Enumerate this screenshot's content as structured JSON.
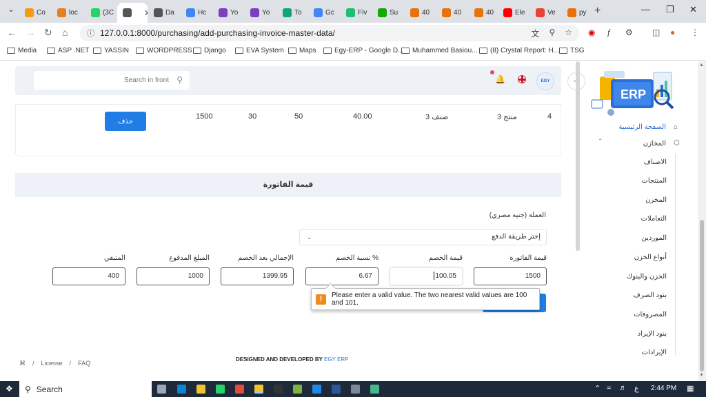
{
  "browser": {
    "tabs": [
      {
        "title": "Co",
        "color": "#f39c12"
      },
      {
        "title": "loc",
        "color": "#e67e22"
      },
      {
        "title": "(3C",
        "color": "#25d366"
      },
      {
        "title": "",
        "color": "#555555",
        "active": true
      },
      {
        "title": "Da",
        "color": "#555555"
      },
      {
        "title": "Hc",
        "color": "#4285f4"
      },
      {
        "title": "Yo",
        "color": "#7b3fbf"
      },
      {
        "title": "Yo",
        "color": "#7b3fbf"
      },
      {
        "title": "To",
        "color": "#10a37f"
      },
      {
        "title": "Gc",
        "color": "#4285f4"
      },
      {
        "title": "Fiv",
        "color": "#1dbf73"
      },
      {
        "title": "Su",
        "color": "#14a800"
      },
      {
        "title": "40",
        "color": "#e8710a"
      },
      {
        "title": "40",
        "color": "#e8710a"
      },
      {
        "title": "40",
        "color": "#e8710a"
      },
      {
        "title": "Ele",
        "color": "#ff0000"
      },
      {
        "title": "Ve",
        "color": "#ea4335"
      },
      {
        "title": "py",
        "color": "#e8710a"
      }
    ],
    "url": "127.0.0.1:8000/purchasing/add-purchasing-invoice-master-data/",
    "bookmarks": [
      "Media",
      "ASP .NET",
      "YASSIN",
      "WORDPRESS",
      "Django",
      "EVA System",
      "Maps",
      "Egy-ERP - Google D...",
      "Muhammed Basiou...",
      "(8) Crystal Report: H...",
      "TSG"
    ]
  },
  "topbar": {
    "search_placeholder": "Search in front",
    "avatar_text": "EGY"
  },
  "table_row": {
    "index": "4",
    "product": "منتج 3",
    "category": "صنف 3",
    "price": "40.00",
    "qty": "50",
    "discount": "30",
    "total": "1500",
    "delete_label": "حذف"
  },
  "invoice": {
    "section_title": "قيمة الفاتورة",
    "currency_label": "العملة (جنيه مصري)",
    "payment_placeholder": "إختر طريقة الدفع",
    "fields": {
      "invoice_value": {
        "label": "قيمة الفاتورة",
        "value": "1500"
      },
      "discount_value": {
        "label": "قيمة الخصم",
        "value": "100.05"
      },
      "discount_percent": {
        "label": "نسبة الخصم %",
        "value": "6.67"
      },
      "total_after_discount": {
        "label": "الإجمالي بعد الخصم",
        "value": "1399.95"
      },
      "paid_amount": {
        "label": "المبلغ المدفوع",
        "value": "1000"
      },
      "remaining": {
        "label": "المتبقي",
        "value": "400"
      }
    },
    "validation_message": "Please enter a valid value. The two nearest valid values are 100 and 101."
  },
  "footer": {
    "license": "License",
    "faq": "FAQ",
    "credit": "DESIGNED AND DEVELOPED BY",
    "brand": "EGY ERP"
  },
  "sidebar": {
    "logo_text": "ERP",
    "home": "الصفحة الرئيسية",
    "warehouses": "المخازن",
    "items": [
      "الاصناف",
      "المنتجات",
      "المخزن",
      "التعاملات",
      "الموردين",
      "أنواع الخزن",
      "الخزن والبنوك",
      "بنود الصرف",
      "المصروفات",
      "بنود الإيراد",
      "الإيرادات"
    ]
  },
  "taskbar": {
    "search": "Search",
    "time": "2:44 PM",
    "lang": "ع"
  }
}
